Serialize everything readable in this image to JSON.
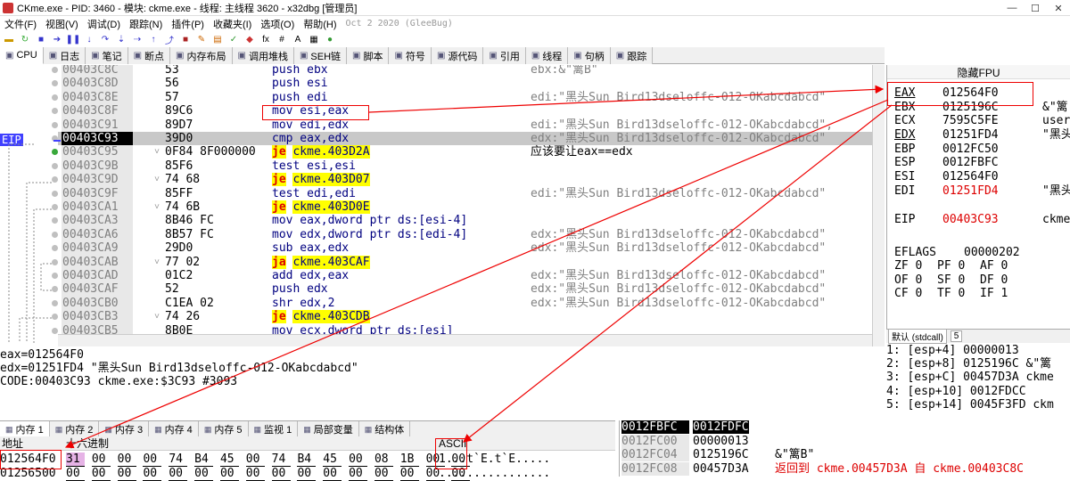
{
  "title": "CKme.exe - PID: 3460 - 模块: ckme.exe - 线程: 主线程 3620 - x32dbg [管理员]",
  "menu": [
    "文件(F)",
    "视图(V)",
    "调试(D)",
    "跟踪(N)",
    "插件(P)",
    "收藏夹(I)",
    "选项(O)",
    "帮助(H)"
  ],
  "build_date": "Oct 2 2020 (GleeBug)",
  "tabs": [
    {
      "label": "CPU",
      "icon": "cpu-icon"
    },
    {
      "label": "日志",
      "icon": "log-icon"
    },
    {
      "label": "笔记",
      "icon": "notes-icon"
    },
    {
      "label": "断点",
      "icon": "breakpoint-icon"
    },
    {
      "label": "内存布局",
      "icon": "memory-map-icon"
    },
    {
      "label": "调用堆栈",
      "icon": "call-stack-icon"
    },
    {
      "label": "SEH链",
      "icon": "seh-icon"
    },
    {
      "label": "脚本",
      "icon": "script-icon"
    },
    {
      "label": "符号",
      "icon": "symbols-icon"
    },
    {
      "label": "源代码",
      "icon": "source-icon"
    },
    {
      "label": "引用",
      "icon": "references-icon"
    },
    {
      "label": "线程",
      "icon": "threads-icon"
    },
    {
      "label": "句柄",
      "icon": "handles-icon"
    },
    {
      "label": "跟踪",
      "icon": "trace-icon"
    }
  ],
  "eip_label": "EIP",
  "disasm": [
    {
      "addr": "00403C8C",
      "bytes": "53",
      "arrow": "",
      "asm": "push ebx",
      "type": "push",
      "comment": "ebx:&\"篱B\""
    },
    {
      "addr": "00403C8D",
      "bytes": "56",
      "arrow": "",
      "asm": "push esi",
      "type": "push",
      "comment": ""
    },
    {
      "addr": "00403C8E",
      "bytes": "57",
      "arrow": "",
      "asm": "push edi",
      "type": "push",
      "comment": "edi:\"黑头Sun Bird13dseloffc-012-OKabcdabcd\""
    },
    {
      "addr": "00403C8F",
      "bytes": "89C6",
      "arrow": "",
      "asm": "mov esi,eax",
      "type": "mov",
      "comment": ""
    },
    {
      "addr": "00403C91",
      "bytes": "89D7",
      "arrow": "",
      "asm": "mov edi,edx",
      "type": "mov",
      "comment": "edi:\"黑头Sun Bird13dseloffc-012-OKabcdabcd\","
    },
    {
      "addr": "00403C93",
      "bytes": "39D0",
      "arrow": "",
      "asm": "cmp eax,edx",
      "type": "cmp",
      "comment": "edx:\"黑头Sun Bird13dseloffc-012-OKabcdabcd\"",
      "sel": true
    },
    {
      "addr": "00403C95",
      "bytes": "0F84 8F000000",
      "arrow": "˅",
      "asm": "je ckme.403D2A",
      "type": "jmp",
      "comment": "应该要让eax==edx",
      "dark": true
    },
    {
      "addr": "00403C9B",
      "bytes": "85F6",
      "arrow": "",
      "asm": "test esi,esi",
      "type": "test",
      "comment": ""
    },
    {
      "addr": "00403C9D",
      "bytes": "74 68",
      "arrow": "˅",
      "asm": "je ckme.403D07",
      "type": "jmp",
      "comment": ""
    },
    {
      "addr": "00403C9F",
      "bytes": "85FF",
      "arrow": "",
      "asm": "test edi,edi",
      "type": "test",
      "comment": "edi:\"黑头Sun Bird13dseloffc-012-OKabcdabcd\""
    },
    {
      "addr": "00403CA1",
      "bytes": "74 6B",
      "arrow": "˅",
      "asm": "je ckme.403D0E",
      "type": "jmp",
      "comment": ""
    },
    {
      "addr": "00403CA3",
      "bytes": "8B46 FC",
      "arrow": "",
      "asm": "mov eax,dword ptr ds:[esi-4]",
      "type": "mov",
      "comment": ""
    },
    {
      "addr": "00403CA6",
      "bytes": "8B57 FC",
      "arrow": "",
      "asm": "mov edx,dword ptr ds:[edi-4]",
      "type": "mov",
      "comment": "edx:\"黑头Sun Bird13dseloffc-012-OKabcdabcd\""
    },
    {
      "addr": "00403CA9",
      "bytes": "29D0",
      "arrow": "",
      "asm": "sub eax,edx",
      "type": "sub",
      "comment": "edx:\"黑头Sun Bird13dseloffc-012-OKabcdabcd\""
    },
    {
      "addr": "00403CAB",
      "bytes": "77 02",
      "arrow": "˅",
      "asm": "ja ckme.403CAF",
      "type": "jmp",
      "comment": ""
    },
    {
      "addr": "00403CAD",
      "bytes": "01C2",
      "arrow": "",
      "asm": "add edx,eax",
      "type": "add",
      "comment": "edx:\"黑头Sun Bird13dseloffc-012-OKabcdabcd\""
    },
    {
      "addr": "00403CAF",
      "bytes": "52",
      "arrow": "",
      "asm": "push edx",
      "type": "push",
      "comment": "edx:\"黑头Sun Bird13dseloffc-012-OKabcdabcd\""
    },
    {
      "addr": "00403CB0",
      "bytes": "C1EA 02",
      "arrow": "",
      "asm": "shr edx,2",
      "type": "shr",
      "comment": "edx:\"黑头Sun Bird13dseloffc-012-OKabcdabcd\""
    },
    {
      "addr": "00403CB3",
      "bytes": "74 26",
      "arrow": "˅",
      "asm": "je ckme.403CDB",
      "type": "jmp",
      "comment": ""
    },
    {
      "addr": "00403CB5",
      "bytes": "8B0E",
      "arrow": "",
      "asm": "mov ecx,dword ptr ds:[esi]",
      "type": "mov",
      "comment": ""
    }
  ],
  "info_lines": [
    "eax=012564F0",
    "edx=01251FD4 \"黑头Sun Bird13dseloffc-012-OKabcdabcd\"",
    "",
    "CODE:00403C93 ckme.exe:$3C93 #3093"
  ],
  "regs": {
    "header": "隐藏FPU",
    "list": [
      {
        "name": "EAX",
        "val": "012564F0",
        "extra": "",
        "red": false,
        "u": true
      },
      {
        "name": "EBX",
        "val": "0125196C",
        "extra": "&\"篱",
        "red": false,
        "u": false
      },
      {
        "name": "ECX",
        "val": "7595C5FE",
        "extra": "user",
        "red": false,
        "u": false
      },
      {
        "name": "EDX",
        "val": "01251FD4",
        "extra": "\"黑头",
        "red": false,
        "u": true
      },
      {
        "name": "EBP",
        "val": "0012FC50",
        "extra": "",
        "red": false,
        "u": false
      },
      {
        "name": "ESP",
        "val": "0012FBFC",
        "extra": "",
        "red": false,
        "u": false
      },
      {
        "name": "ESI",
        "val": "012564F0",
        "extra": "",
        "red": false,
        "u": false
      },
      {
        "name": "EDI",
        "val": "01251FD4",
        "extra": "\"黑头",
        "red": true,
        "u": false
      },
      {
        "name": "EIP",
        "val": "00403C93",
        "extra": "ckme",
        "red": true,
        "u": false
      }
    ],
    "eflags_label": "EFLAGS",
    "eflags_val": "00000202",
    "flags": [
      [
        "ZF 0",
        "PF 0",
        "AF 0"
      ],
      [
        "OF 0",
        "SF 0",
        "DF 0"
      ],
      [
        "CF 0",
        "TF 0",
        "IF 1"
      ]
    ]
  },
  "stack_header": {
    "conv": "默认 (stdcall)",
    "count": "5"
  },
  "args": [
    "1: [esp+4] 00000013",
    "2: [esp+8] 0125196C &\"篱",
    "3: [esp+C] 00457D3A ckme",
    "4: [esp+10] 0012FDCC",
    "5: [esp+14] 0045F3FD ckm"
  ],
  "mem_tabs": [
    "内存 1",
    "内存 2",
    "内存 3",
    "内存 4",
    "内存 5",
    "监视 1",
    "局部变量",
    "结构体"
  ],
  "dump_header": {
    "addr": "地址",
    "hex": "十六进制",
    "ascii": "ASCII"
  },
  "dump": [
    {
      "addr": "012564F0",
      "hex": [
        "31",
        "00",
        "00",
        "00",
        "74",
        "B4",
        "45",
        "00",
        "74",
        "B4",
        "45",
        "00",
        "08",
        "1B",
        "00",
        "00"
      ],
      "ascii": "1...t`E.t`E....."
    },
    {
      "addr": "01256500",
      "hex": [
        "00",
        "00",
        "00",
        "00",
        "00",
        "00",
        "00",
        "00",
        "00",
        "00",
        "00",
        "00",
        "00",
        "00",
        "00",
        "00"
      ],
      "ascii": "................"
    }
  ],
  "stack": [
    {
      "addr": "0012FBFC",
      "val": "0012FDFC",
      "cmt": "",
      "top": true
    },
    {
      "addr": "0012FC00",
      "val": "00000013",
      "cmt": ""
    },
    {
      "addr": "0012FC04",
      "val": "0125196C",
      "cmt": "&\"篱B\""
    },
    {
      "addr": "0012FC08",
      "val": "00457D3A",
      "cmt": "返回到 ckme.00457D3A 自 ckme.00403C8C",
      "red": true
    }
  ]
}
